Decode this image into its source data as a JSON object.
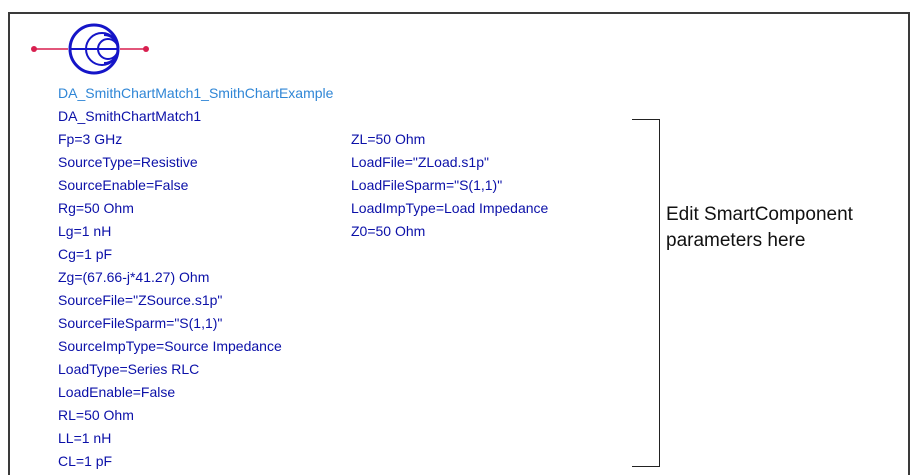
{
  "schematic": {
    "instance_name": "DA_SmithChartMatch1_SmithChartExample",
    "component_name": "DA_SmithChartMatch1",
    "colors": {
      "instance_name": "#2f86d6",
      "parameters": "#0b10a8",
      "symbol": "#1515c8",
      "pins": "#d81f4f",
      "note": "#111111"
    },
    "symbol_icon": "smith-chart-icon",
    "params_left": [
      "Fp=3 GHz",
      "SourceType=Resistive",
      "SourceEnable=False",
      "Rg=50 Ohm",
      "Lg=1 nH",
      "Cg=1 pF",
      "Zg=(67.66-j*41.27) Ohm",
      "SourceFile=\"ZSource.s1p\"",
      "SourceFileSparm=\"S(1,1)\"",
      "SourceImpType=Source Impedance",
      "LoadType=Series RLC",
      "LoadEnable=False",
      "RL=50 Ohm",
      "LL=1 nH",
      "CL=1 pF"
    ],
    "params_right": [
      "ZL=50 Ohm",
      "LoadFile=\"ZLoad.s1p\"",
      "LoadFileSparm=\"S(1,1)\"",
      "LoadImpType=Load Impedance",
      "Z0=50 Ohm"
    ]
  },
  "note": {
    "line1": "Edit SmartComponent",
    "line2": "parameters here"
  }
}
